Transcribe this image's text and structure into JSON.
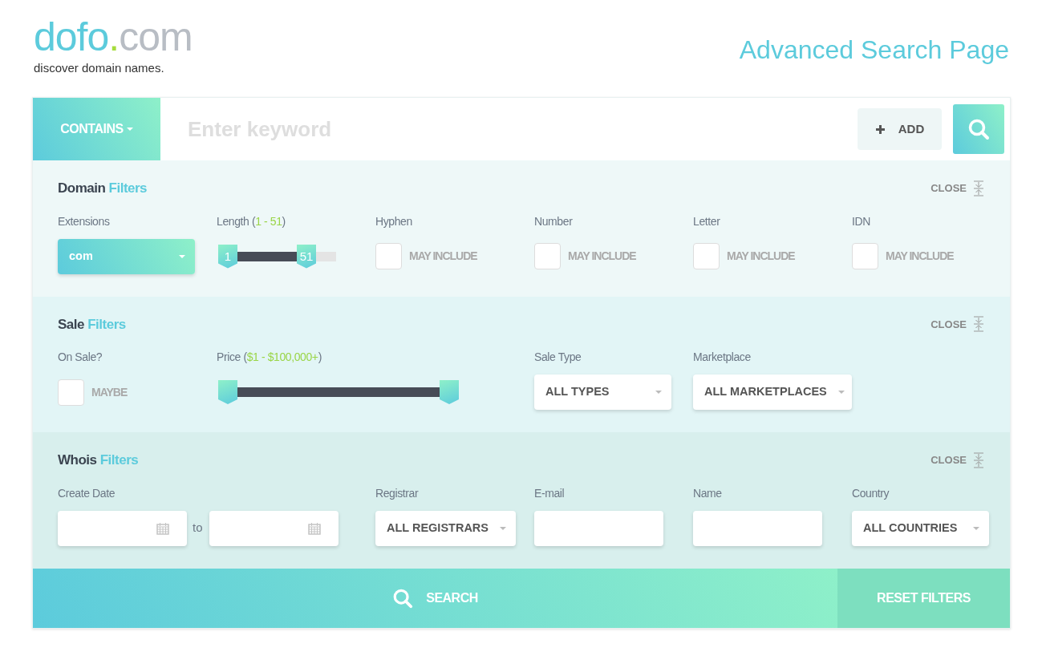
{
  "logo": {
    "name": "dofo",
    "dot": ".",
    "tld": "com",
    "tagline": "discover domain names."
  },
  "page_title": "Advanced Search Page",
  "search": {
    "mode": "CONTAINS",
    "placeholder": "Enter keyword",
    "add_label": "ADD"
  },
  "sections": [
    {
      "title": "Domain",
      "title_accent": "Filters",
      "close": "CLOSE",
      "fields": [
        {
          "kind": "select",
          "label": "Extensions",
          "value": "com",
          "highlighted": true
        },
        {
          "kind": "range",
          "label": "Length (",
          "accent": "1 - 51",
          "label_end": ")",
          "wide": false,
          "low_label": "1",
          "high_label": "51",
          "level": 0.83
        },
        {
          "kind": "checkbox",
          "label": "Hyphen",
          "text": "MAY INCLUDE",
          "checked": false
        },
        {
          "kind": "checkbox",
          "label": "Number",
          "text": "MAY INCLUDE",
          "checked": false
        },
        {
          "kind": "checkbox",
          "label": "Letter",
          "text": "MAY INCLUDE",
          "checked": false
        },
        {
          "kind": "checkbox",
          "label": "IDN",
          "text": "MAY INCLUDE",
          "checked": false
        }
      ]
    },
    {
      "title": "Sale",
      "title_accent": "Filters",
      "close": "CLOSE",
      "fields": [
        {
          "kind": "checkbox",
          "label": "On Sale?",
          "text": "MAYBE",
          "checked": false
        },
        {
          "kind": "range",
          "label": "Price (",
          "accent": "$1 - $100,000+",
          "label_end": ")",
          "wide": true,
          "level": 1
        },
        {
          "kind": "select",
          "label": "Sale Type",
          "value": "ALL TYPES",
          "highlighted": false
        },
        {
          "kind": "select",
          "label": "Marketplace",
          "value": "ALL MARKETPLACES",
          "highlighted": false
        }
      ]
    },
    {
      "title": "Whois",
      "title_accent": "Filters",
      "close": "CLOSE",
      "fields": [
        {
          "kind": "daterange",
          "label": "Create Date",
          "between": "to"
        },
        {
          "kind": "select",
          "label": "Registrar",
          "value": "ALL REGISTRARS",
          "highlighted": false
        },
        {
          "kind": "text",
          "label": "E-mail"
        },
        {
          "kind": "text",
          "label": "Name"
        },
        {
          "kind": "select",
          "label": "Country",
          "value": "ALL COUNTRIES",
          "highlighted": false
        }
      ]
    }
  ],
  "footer": {
    "search_label": "SEARCH",
    "reset_label": "RESET FILTERS"
  }
}
